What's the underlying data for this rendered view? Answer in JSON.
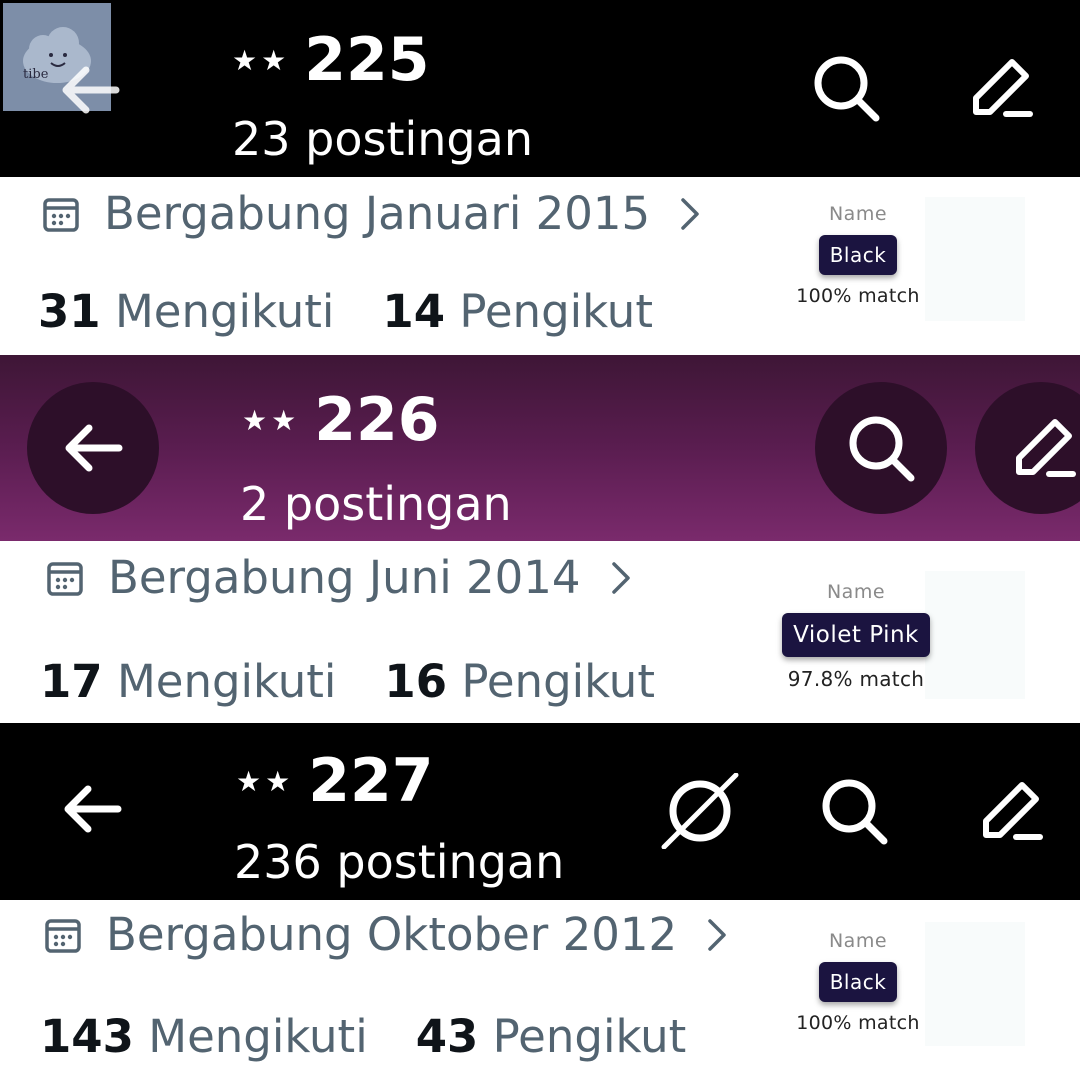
{
  "profiles": [
    {
      "stars": "★★",
      "number": "225",
      "posts": "23 postingan",
      "joined": "Bergabung Januari 2015",
      "following_count": "31",
      "following_label": "Mengikuti",
      "followers_count": "14",
      "followers_label": "Pengikut",
      "color_name_label": "Name",
      "color_name": "Black",
      "color_match": "100% match",
      "avatar_text": "tibe"
    },
    {
      "stars": "★★",
      "number": "226",
      "posts": "2 postingan",
      "joined": "Bergabung Juni 2014",
      "following_count": "17",
      "following_label": "Mengikuti",
      "followers_count": "16",
      "followers_label": "Pengikut",
      "color_name_label": "Name",
      "color_name": "Violet Pink",
      "color_match": "97.8% match"
    },
    {
      "stars": "★★",
      "number": "227",
      "posts": "236 postingan",
      "joined": "Bergabung Oktober 2012",
      "following_count": "143",
      "following_label": "Mengikuti",
      "followers_count": "43",
      "followers_label": "Pengikut",
      "color_name_label": "Name",
      "color_name": "Black",
      "color_match": "100% match"
    }
  ],
  "icons": [
    "back-arrow-icon",
    "search-icon",
    "edit-icon",
    "calendar-icon",
    "chevron-right-icon",
    "no-sign-icon",
    "cloud-avatar-icon"
  ],
  "colors": {
    "header_black": "#000000",
    "header_purple_top": "#3e1636",
    "header_purple_bottom": "#7a2a6c",
    "muted_text": "#536471",
    "strong_text": "#0f1419",
    "pill_bg": "#1b1440"
  }
}
